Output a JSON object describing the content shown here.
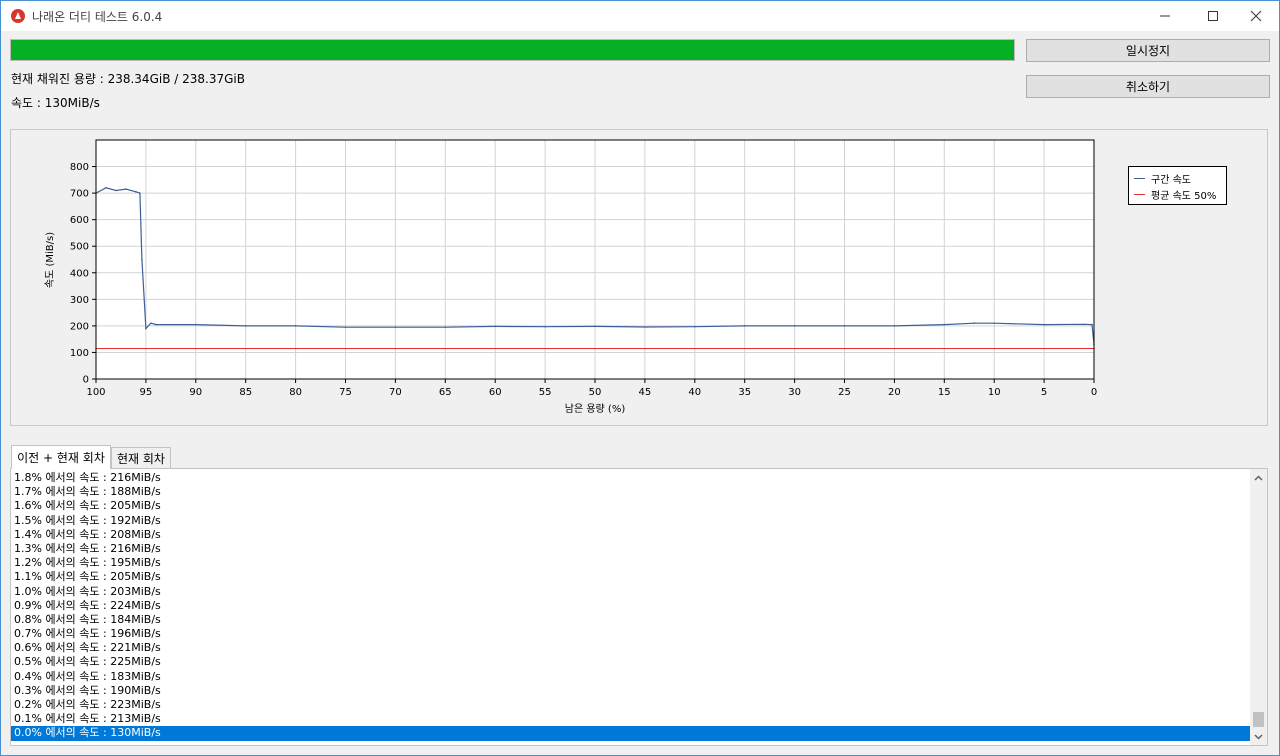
{
  "window": {
    "title": "나래온 더티 테스트 6.0.4",
    "minimize_icon": "minimize-icon",
    "maximize_icon": "maximize-icon",
    "close_icon": "close-icon"
  },
  "progress": {
    "value": 0.9999,
    "color": "#06b025"
  },
  "status": {
    "filled": "현재 채워진 용량 : 238.34GiB / 238.37GiB",
    "speed": "속도 : 130MiB/s"
  },
  "buttons": {
    "pause": "일시정지",
    "cancel": "취소하기"
  },
  "chart_data": {
    "type": "line",
    "title": "",
    "xlabel": "남은 용량 (%)",
    "ylabel": "속도 (MiB/s)",
    "xlim": [
      100,
      0
    ],
    "ylim": [
      0,
      900
    ],
    "x_ticks": [
      "100",
      "95",
      "90",
      "85",
      "80",
      "75",
      "70",
      "65",
      "60",
      "55",
      "50",
      "45",
      "40",
      "35",
      "30",
      "25",
      "20",
      "15",
      "10",
      "5",
      "0"
    ],
    "y_ticks": [
      "0",
      "100",
      "200",
      "300",
      "400",
      "500",
      "600",
      "700",
      "800"
    ],
    "grid": true,
    "legend_position": "right",
    "series": [
      {
        "name": "구간 속도",
        "color": "#3c5f96",
        "x": [
          100,
          99,
          98,
          97,
          96,
          95.6,
          95.4,
          95,
          94.5,
          94,
          90,
          85,
          80,
          75,
          70,
          65,
          60,
          55,
          50,
          45,
          40,
          35,
          30,
          25,
          20,
          15,
          12,
          10,
          5,
          1,
          0.2,
          0
        ],
        "y": [
          700,
          720,
          710,
          715,
          705,
          700,
          450,
          190,
          210,
          205,
          205,
          200,
          200,
          195,
          195,
          195,
          198,
          197,
          198,
          196,
          197,
          200,
          200,
          200,
          200,
          205,
          210,
          210,
          205,
          206,
          205,
          130
        ]
      },
      {
        "name": "평균 속도 50%",
        "color": "#e03030",
        "x": [
          100,
          0
        ],
        "y": [
          115,
          115
        ]
      }
    ]
  },
  "tabs": {
    "previous_and_current": "이전 + 현재 회차",
    "current": "현재 회차"
  },
  "list": {
    "items": [
      "1.8% 에서의 속도 : 216MiB/s",
      "1.7% 에서의 속도 : 188MiB/s",
      "1.6% 에서의 속도 : 205MiB/s",
      "1.5% 에서의 속도 : 192MiB/s",
      "1.4% 에서의 속도 : 208MiB/s",
      "1.3% 에서의 속도 : 216MiB/s",
      "1.2% 에서의 속도 : 195MiB/s",
      "1.1% 에서의 속도 : 205MiB/s",
      "1.0% 에서의 속도 : 203MiB/s",
      "0.9% 에서의 속도 : 224MiB/s",
      "0.8% 에서의 속도 : 184MiB/s",
      "0.7% 에서의 속도 : 196MiB/s",
      "0.6% 에서의 속도 : 221MiB/s",
      "0.5% 에서의 속도 : 225MiB/s",
      "0.4% 에서의 속도 : 183MiB/s",
      "0.3% 에서의 속도 : 190MiB/s",
      "0.2% 에서의 속도 : 223MiB/s",
      "0.1% 에서의 속도 : 213MiB/s",
      "0.0% 에서의 속도 : 130MiB/s"
    ],
    "selected_index": 18
  },
  "colors": {
    "accent": "#0078d7",
    "progress": "#06b025"
  }
}
